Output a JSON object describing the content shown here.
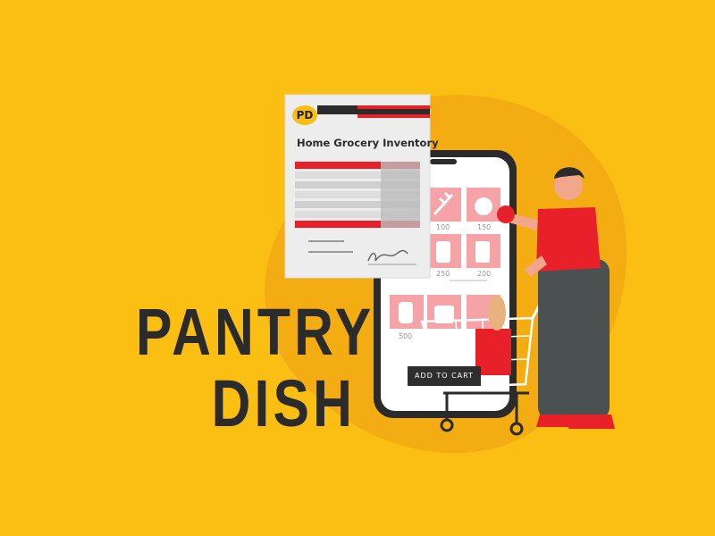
{
  "colors": {
    "background": "#FBBF14",
    "accent_red": "#E8202A",
    "pink_tile": "#F5A3A6",
    "dark": "#2B2B2B",
    "pants": "#4A5150",
    "skin": "#F2A78C"
  },
  "brand": {
    "logo_text": "PD",
    "title_line1": "PANTRY",
    "title_line2": "DISH"
  },
  "document": {
    "title": "Home Grocery Inventory"
  },
  "phone": {
    "prices": [
      "100",
      "150",
      "250",
      "200",
      "500"
    ],
    "add_to_cart_label": "ADD TO CART"
  }
}
